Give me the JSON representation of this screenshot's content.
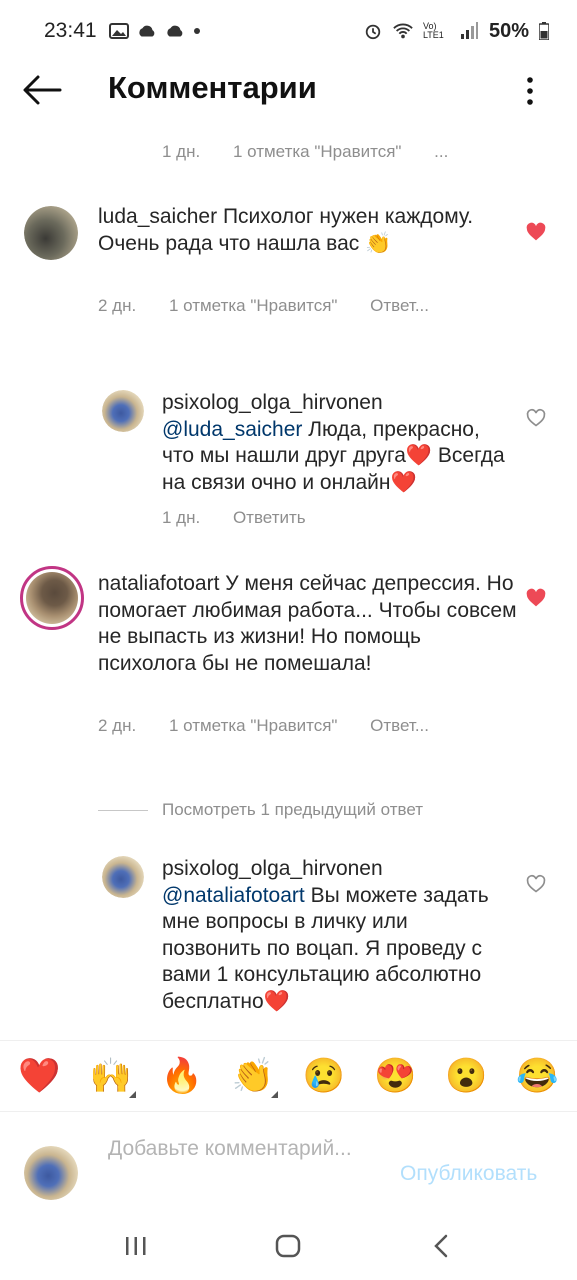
{
  "status": {
    "time": "23:41",
    "network": "Vo) LTE1",
    "battery": "50%"
  },
  "header": {
    "title": "Комментарии"
  },
  "top_meta": {
    "time": "1 дн.",
    "likes": "1 отметка \"Нравится\"",
    "more": "..."
  },
  "comments": [
    {
      "username": "luda_saicher",
      "text": "Психолог нужен каждому. Очень рада что нашла вас 👏",
      "time": "2 дн.",
      "likes": "1 отметка \"Нравится\"",
      "reply": "Ответ..."
    },
    {
      "username": "psixolog_olga_hirvonen",
      "mention": "@luda_saicher",
      "text": " Люда, прекрасно, что мы нашли друг друга❤️ Всегда на связи очно и онлайн❤️",
      "time": "1 дн.",
      "reply": "Ответить"
    },
    {
      "username": "nataliafotoart",
      "text": "У меня сейчас депрессия. Но помогает любимая работа... Чтобы совсем не выпасть из жизни! Но  помощь психолога бы не помешала!",
      "time": "2 дн.",
      "likes": "1 отметка \"Нравится\"",
      "reply": "Ответ..."
    },
    {
      "username": "psixolog_olga_hirvonen",
      "mention": "@nataliafotoart",
      "text": " Вы можете задать мне вопросы в личку или позвонить по воцап. Я проведу с вами 1 консультацию абсолютно бесплатно❤️"
    }
  ],
  "view_replies": "Посмотреть 1 предыдущий ответ",
  "emoji_bar": [
    "❤️",
    "🙌",
    "🔥",
    "👏",
    "😢",
    "😍",
    "😮",
    "😂"
  ],
  "composer": {
    "placeholder": "Добавьте комментарий...",
    "publish": "Опубликовать"
  },
  "colors": {
    "liked_heart": "#ed4956",
    "mention": "#00376b",
    "publish_disabled": "#b2dffc"
  }
}
